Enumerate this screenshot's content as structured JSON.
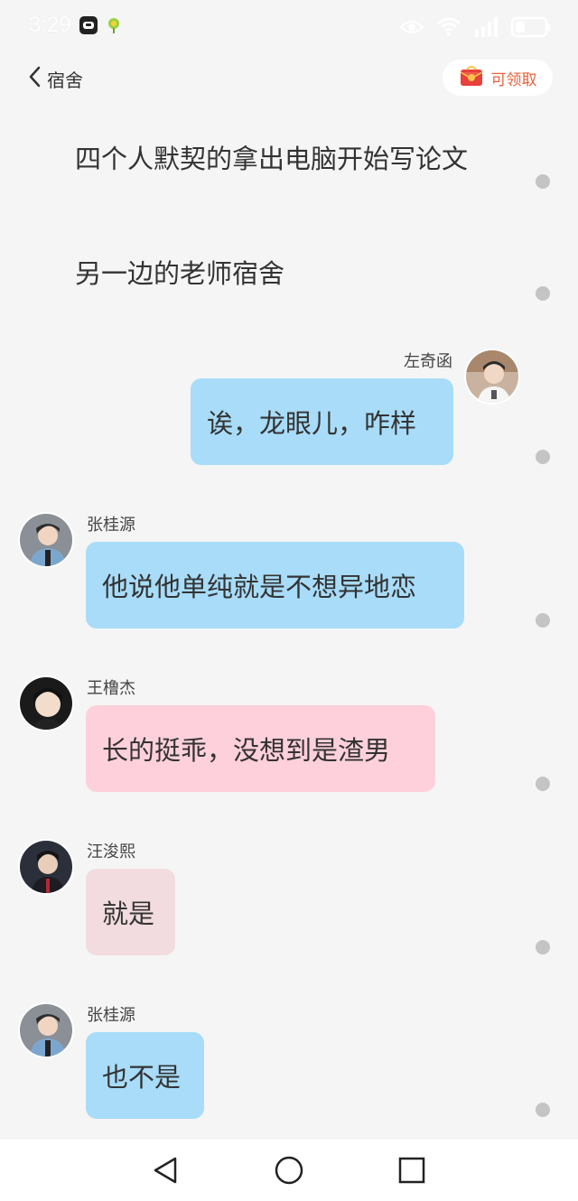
{
  "status_bar": {
    "time": "3:29"
  },
  "header": {
    "back_label": "宿舍",
    "claim_label": "可领取"
  },
  "narration": [
    {
      "text": "四个人默契的拿出电脑开始写论文"
    },
    {
      "text": "另一边的老师宿舍"
    }
  ],
  "messages": [
    {
      "sender": "左奇函",
      "text": "诶，龙眼儿，咋样",
      "side": "right",
      "color": "#a8dcf8"
    },
    {
      "sender": "张桂源",
      "text": "他说他单纯就是不想异地恋",
      "side": "left",
      "color": "#a8dcf8"
    },
    {
      "sender": "王橹杰",
      "text": "长的挺乖，没想到是渣男",
      "side": "left",
      "color": "#fdd0dc"
    },
    {
      "sender": "汪浚熙",
      "text": "就是",
      "side": "left",
      "color": "#f2dcdf"
    },
    {
      "sender": "张桂源",
      "text": "也不是",
      "side": "left",
      "color": "#a8dcf8"
    }
  ],
  "icons": {
    "back": "chevron-left-icon",
    "claim": "red-envelope-icon",
    "eye": "eye-icon",
    "wifi": "wifi-icon",
    "signal": "signal-icon",
    "battery": "battery-icon",
    "nav_back": "triangle-back-icon",
    "nav_home": "circle-home-icon",
    "nav_recent": "square-recent-icon"
  }
}
